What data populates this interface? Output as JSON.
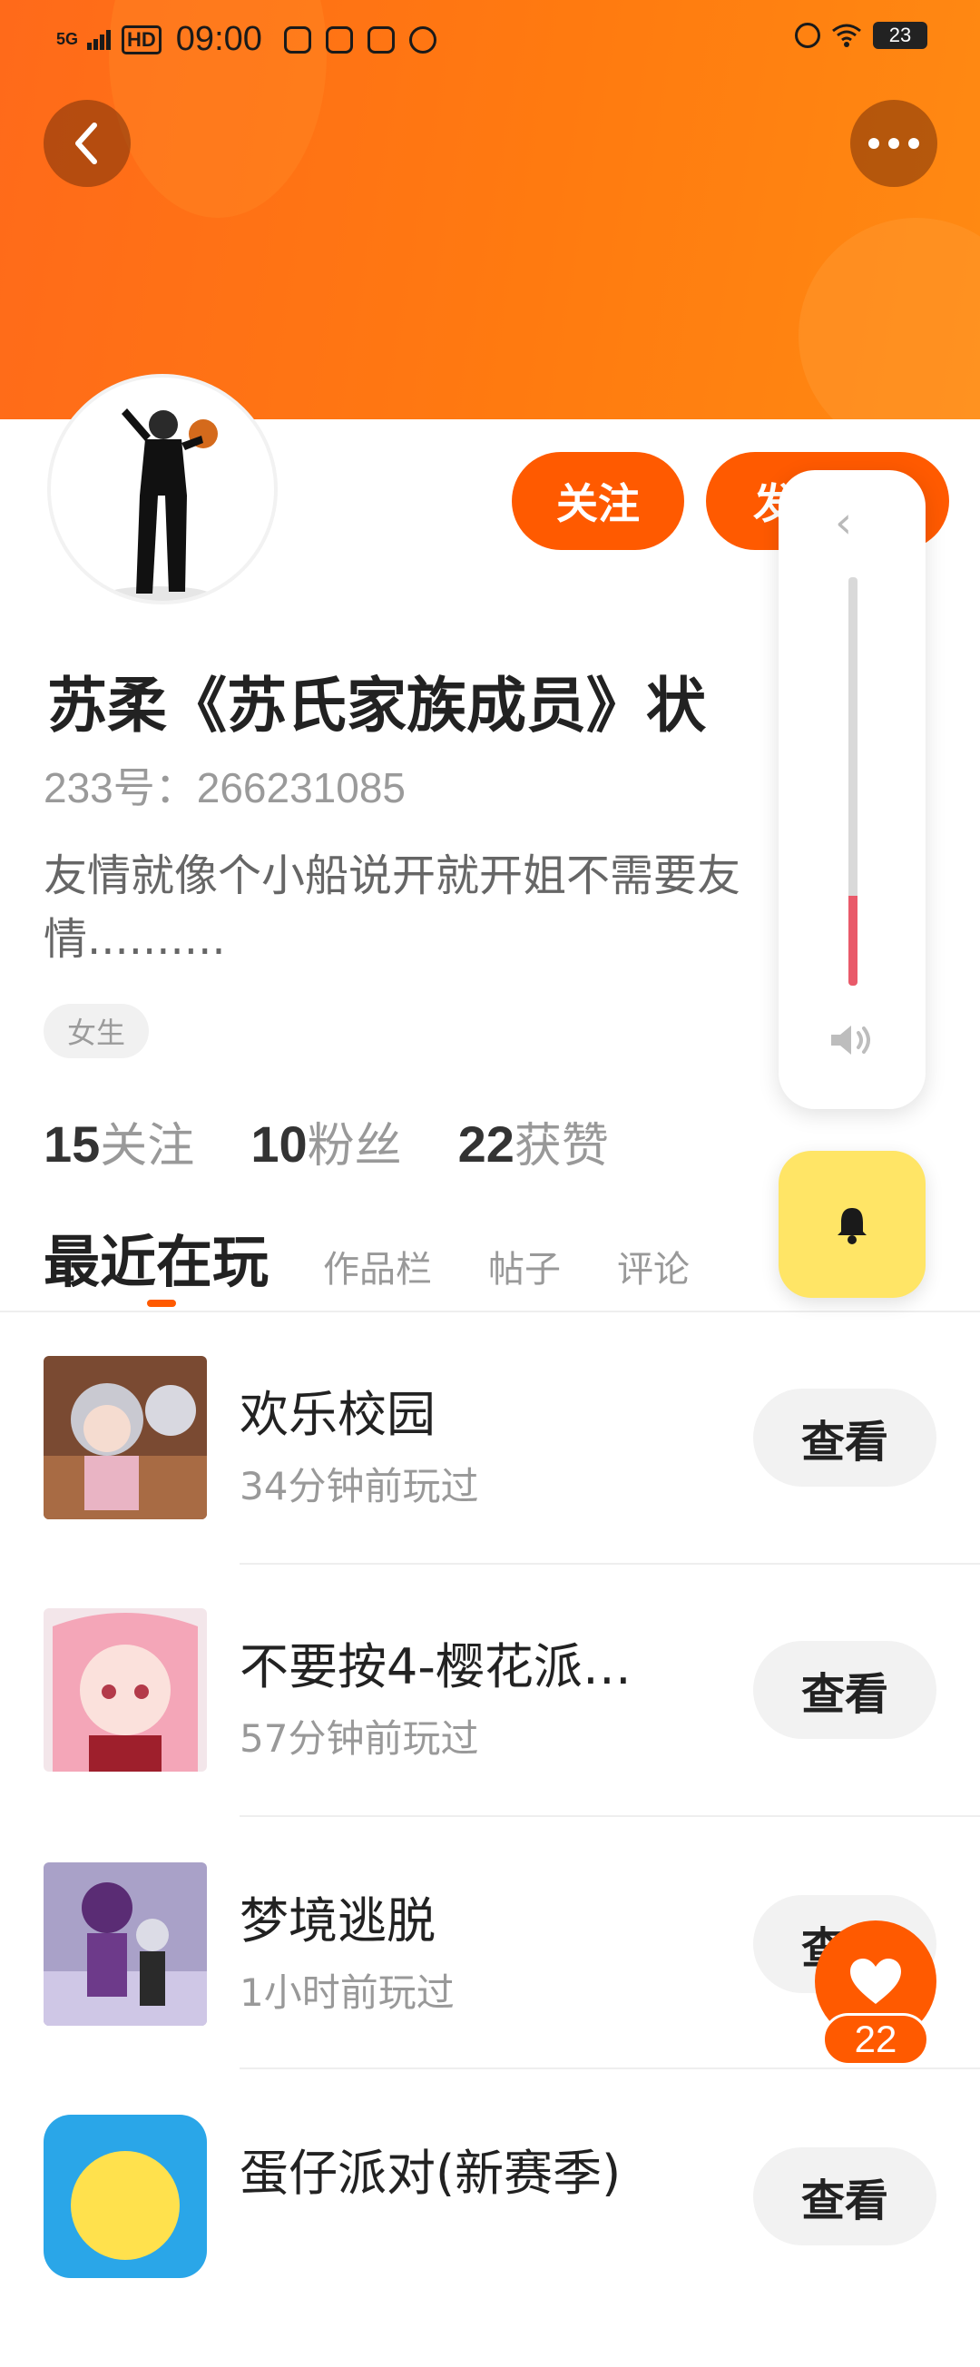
{
  "status_bar": {
    "signal": "5G",
    "hd": "HD",
    "time": "09:00",
    "battery": "23"
  },
  "header": {
    "back_icon": "chevron-left-icon",
    "more_icon": "more-dots-icon",
    "more_label": "•••",
    "colors": {
      "gradient_start": "#ff6a1a",
      "gradient_end": "#ff8a12"
    }
  },
  "profile": {
    "name": "苏柔《苏氏家族成员》状",
    "id_line": "233号：266231085",
    "bio": "友情就像个小船说开就开姐不需要友情..........",
    "tag": "女生",
    "follow_label": "关注",
    "message_label": "发"
  },
  "stats": [
    {
      "num": "15",
      "label": "关注"
    },
    {
      "num": "10",
      "label": "粉丝"
    },
    {
      "num": "22",
      "label": "获赞"
    }
  ],
  "tabs": {
    "active": "最近在玩",
    "others": [
      "作品栏",
      "帖子",
      "评论"
    ]
  },
  "games": [
    {
      "name": "欢乐校园",
      "time": "34分钟前玩过",
      "view": "查看"
    },
    {
      "name": "不要按4-樱花派…",
      "time": "57分钟前玩过",
      "view": "查看"
    },
    {
      "name": "梦境逃脱",
      "time": "1小时前玩过",
      "view": "查看"
    },
    {
      "name": "蛋仔派对(新赛季)",
      "time": "",
      "view": "查看"
    }
  ],
  "volume_panel": {
    "level_fraction": 0.22,
    "chevron": "‹"
  },
  "like": {
    "count": "22"
  },
  "accent_color": "#ff5a00"
}
